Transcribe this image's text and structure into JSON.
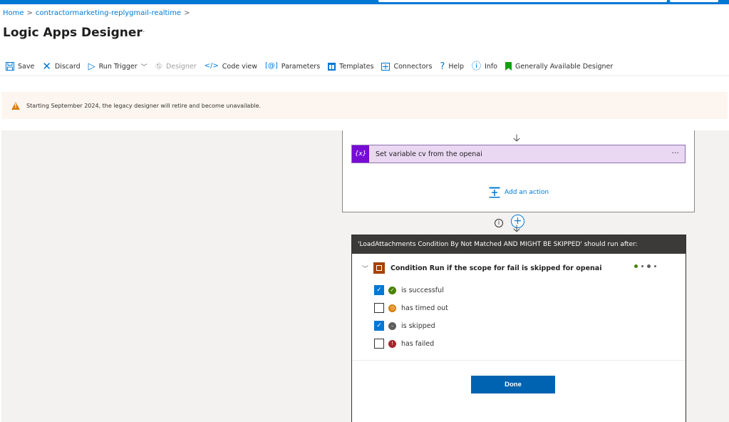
{
  "breadcrumb": {
    "home": "Home",
    "resource": "contractormarketing-replygmail-realtime"
  },
  "page": {
    "title": "Logic Apps Designer",
    "more": "···"
  },
  "toolbar": {
    "save": "Save",
    "discard": "Discard",
    "run_trigger": "Run Trigger",
    "designer": "Designer",
    "code_view": "Code view",
    "parameters": "Parameters",
    "templates": "Templates",
    "connectors": "Connectors",
    "help": "Help",
    "info": "Info",
    "ga_designer": "Generally Available Designer"
  },
  "warning": {
    "text": "Starting September 2024, the legacy designer will retire and become unavailable."
  },
  "canvas": {
    "action_label": "Set variable cv from the openai",
    "action_icon": "{x}",
    "action_more": "···",
    "add_action": "Add an action"
  },
  "run_after_panel": {
    "header": "'LoadAttachments Condition By Not Matched AND MIGHT BE SKIPPED' should run after:",
    "condition_name": "Condition Run if the scope for fail is skipped for openai",
    "options": [
      {
        "label": "is successful",
        "checked": true,
        "color": "#498205"
      },
      {
        "label": "has timed out",
        "checked": false,
        "color": "#d97f0f"
      },
      {
        "label": "is skipped",
        "checked": true,
        "color": "#605e5c"
      },
      {
        "label": "has failed",
        "checked": false,
        "color": "#a4262c"
      }
    ],
    "done": "Done"
  },
  "colors": {
    "accent": "#0078d4",
    "variable": "#770bd6",
    "scope": "#a4430a"
  }
}
